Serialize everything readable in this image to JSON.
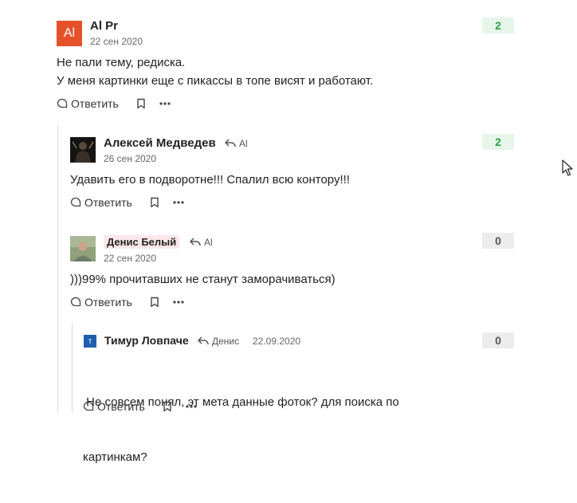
{
  "comments": [
    {
      "author": "Al Pr",
      "avatar_initials": "Al",
      "date": "22 сен 2020",
      "text_lines": [
        "Не пали тему, редиска.",
        "У меня картинки еще с пикассы в топе висят и работают."
      ],
      "score": "2",
      "reply_label": "Ответить"
    },
    {
      "author": "Алексей Медведев",
      "reply_to": "Al",
      "date": "26 сен 2020",
      "text_lines": [
        "Удавить его в подворотне!!! Спалил всю контору!!!"
      ],
      "score": "2",
      "reply_label": "Ответить"
    },
    {
      "author": "Денис Белый",
      "reply_to": "Al",
      "date": "22 сен 2020",
      "text_lines": [
        ")))99% прочитавших не станут заморачиваться)"
      ],
      "score": "0",
      "reply_label": "Ответить"
    },
    {
      "author": "Тимур Ловпаче",
      "avatar_initials": "т",
      "reply_to": "Денис",
      "date": "22.09.2020",
      "text_lines": [
        " Не совсем понял, эт мета данные фоток? для поиска по",
        "картинкам?"
      ],
      "score": "0",
      "reply_label": "Ответить"
    }
  ],
  "colors": {
    "avatar_orange": "#e5512b",
    "score_positive_bg": "#e7f6ea",
    "score_positive_text": "#2e9e46",
    "score_zero_bg": "#ececec",
    "name_highlight_bg": "#fde7ea",
    "avatar_blue": "#1f5fae"
  }
}
